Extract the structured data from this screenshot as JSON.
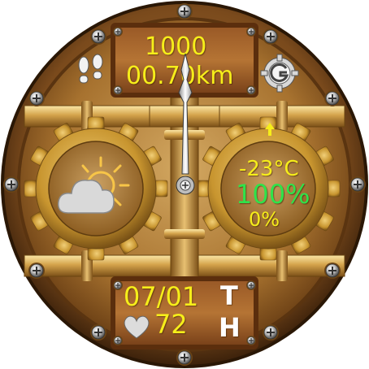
{
  "top": {
    "steps": "1000",
    "distance": "00.70km"
  },
  "weather": {
    "temperature": "-23°C",
    "humidity": "100%",
    "precipitation": "0%",
    "icon": "partly-cloudy-icon"
  },
  "bottom": {
    "date": "07/01",
    "heart_rate": "72",
    "day_line1": "T",
    "day_line2": "H"
  },
  "icons": {
    "steps": "footprints-icon",
    "settings": "gear-g-icon",
    "heart": "heart-icon",
    "arrow": "arrow-up-icon"
  },
  "colors": {
    "accent_yellow": "#f6ee1a",
    "accent_green": "#2fe34a",
    "brass": "#b8893d",
    "copper": "#8a5520"
  }
}
